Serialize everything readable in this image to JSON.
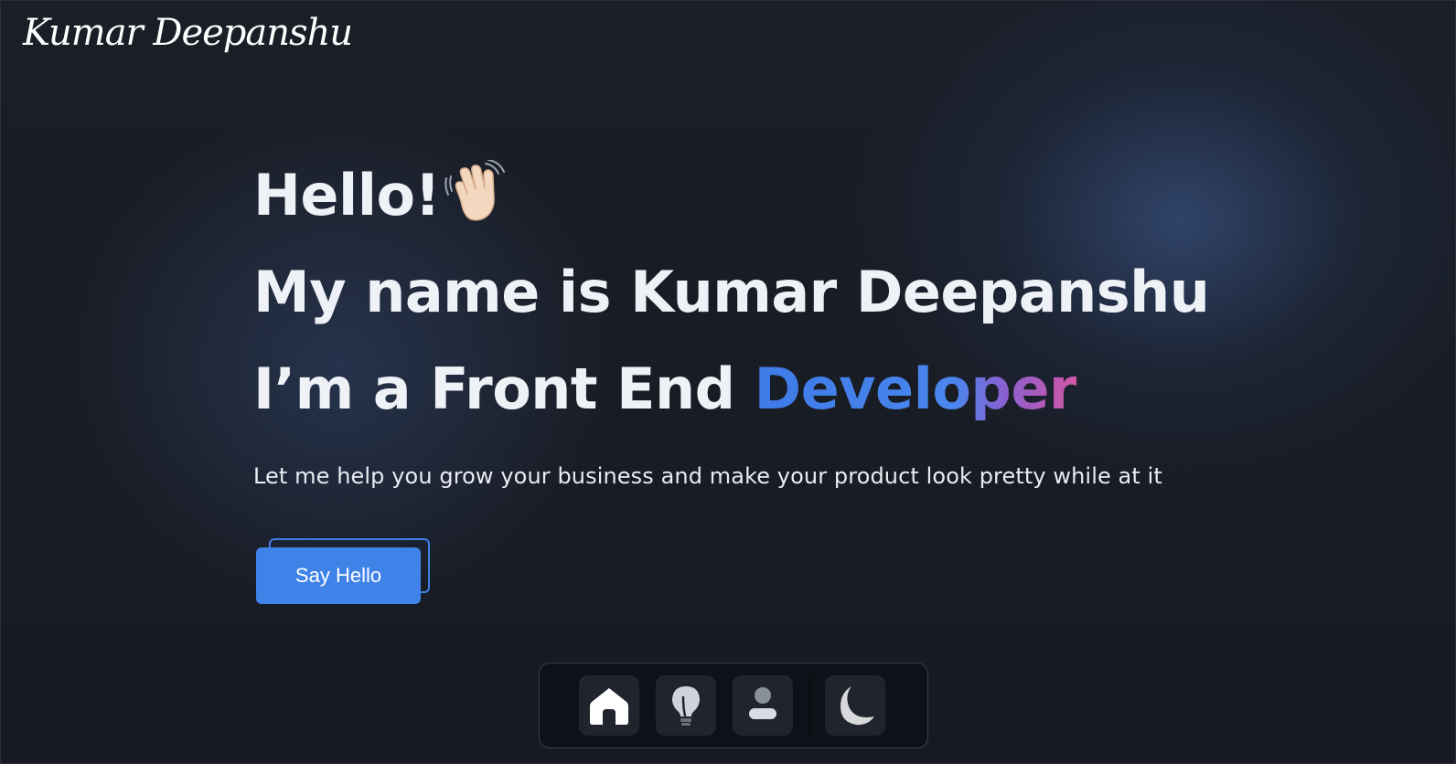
{
  "header": {
    "logo_text": "Kumar Deepanshu"
  },
  "hero": {
    "greeting": "Hello!",
    "greeting_emoji_icon": "waving-hand-icon",
    "name_line": "My name is Kumar Deepanshu",
    "role_prefix": "I’m a Front End ",
    "role_highlight": "Developer",
    "tagline": "Let me help you grow your business and make your product look pretty while at it",
    "cta_label": "Say Hello"
  },
  "dock": {
    "items": [
      {
        "icon": "home-icon",
        "active": true
      },
      {
        "icon": "lightbulb-icon",
        "active": false
      },
      {
        "icon": "user-icon",
        "active": false
      },
      {
        "icon": "moon-icon",
        "active": false
      }
    ]
  },
  "colors": {
    "accent": "#3f82e8",
    "highlight_gradient_start": "#3f7be8",
    "highlight_gradient_end": "#d257a6",
    "background": "#16191f"
  }
}
